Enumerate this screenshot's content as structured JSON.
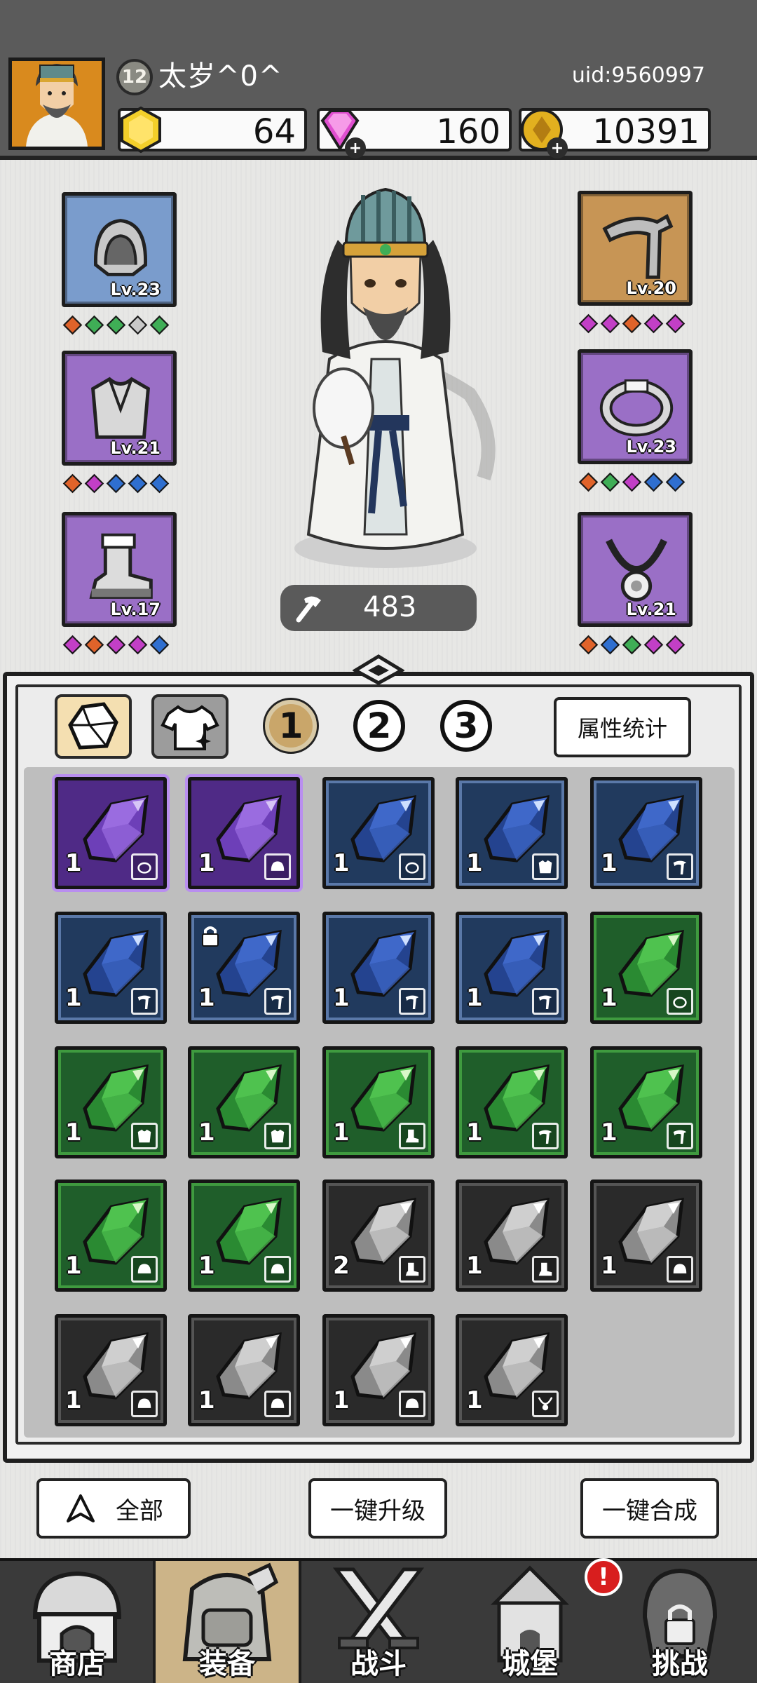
{
  "header": {
    "player_level": "12",
    "player_name": "太岁^0^",
    "uid": "uid:9560997",
    "resources": [
      {
        "icon": "gold-hexagon-icon",
        "value": "64"
      },
      {
        "icon": "pink-diamond-icon",
        "value": "160"
      },
      {
        "icon": "gold-coin-icon",
        "value": "10391"
      }
    ]
  },
  "equipment": {
    "left": [
      {
        "slot": "helmet",
        "level": "Lv.23",
        "rarity_color": "#7a9ccc",
        "gems": [
          "#e0632a",
          "#3fae56",
          "#3fae56",
          "#c8c8c8",
          "#3fae56"
        ]
      },
      {
        "slot": "armor",
        "level": "Lv.21",
        "rarity_color": "#9a6fc6",
        "gems": [
          "#e0632a",
          "#c23fc6",
          "#2f6fd0",
          "#2f6fd0",
          "#2f6fd0"
        ]
      },
      {
        "slot": "boots",
        "level": "Lv.17",
        "rarity_color": "#9a6fc6",
        "gems": [
          "#c23fc6",
          "#e0632a",
          "#c23fc6",
          "#c23fc6",
          "#2f6fd0"
        ]
      }
    ],
    "right": [
      {
        "slot": "weapon",
        "level": "Lv.20",
        "rarity_color": "#c79555",
        "gems": [
          "#c23fc6",
          "#c23fc6",
          "#e0632a",
          "#c23fc6",
          "#c23fc6"
        ]
      },
      {
        "slot": "ring",
        "level": "Lv.23",
        "rarity_color": "#9a6fc6",
        "gems": [
          "#e0632a",
          "#3fae56",
          "#c23fc6",
          "#2f6fd0",
          "#2f6fd0"
        ]
      },
      {
        "slot": "necklace",
        "level": "Lv.21",
        "rarity_color": "#9a6fc6",
        "gems": [
          "#e0632a",
          "#2f6fd0",
          "#3fae56",
          "#c23fc6",
          "#c23fc6"
        ]
      }
    ]
  },
  "combat_power": "483",
  "inventory": {
    "tabs": [
      "gem-tab",
      "equipment-tab"
    ],
    "pages": [
      "1",
      "2",
      "3"
    ],
    "active_page": "1",
    "stats_button": "属性统计",
    "rarity_colors": {
      "purple": "#4f2a86",
      "blue": "#213a5e",
      "green": "#1f5e2a",
      "white": "#2a2a2a"
    },
    "items": [
      {
        "rarity": "purple",
        "count": "1",
        "slot_icon": "ring-icon"
      },
      {
        "rarity": "purple",
        "count": "1",
        "slot_icon": "helmet-icon"
      },
      {
        "rarity": "blue",
        "count": "1",
        "slot_icon": "ring-icon"
      },
      {
        "rarity": "blue",
        "count": "1",
        "slot_icon": "armor-icon"
      },
      {
        "rarity": "blue",
        "count": "1",
        "slot_icon": "weapon-icon"
      },
      {
        "rarity": "blue",
        "count": "1",
        "slot_icon": "weapon-icon"
      },
      {
        "rarity": "blue",
        "count": "1",
        "slot_icon": "weapon-icon",
        "locked": true
      },
      {
        "rarity": "blue",
        "count": "1",
        "slot_icon": "weapon-icon"
      },
      {
        "rarity": "blue",
        "count": "1",
        "slot_icon": "weapon-icon"
      },
      {
        "rarity": "green",
        "count": "1",
        "slot_icon": "ring-icon"
      },
      {
        "rarity": "green",
        "count": "1",
        "slot_icon": "armor-icon"
      },
      {
        "rarity": "green",
        "count": "1",
        "slot_icon": "armor-icon"
      },
      {
        "rarity": "green",
        "count": "1",
        "slot_icon": "boots-icon"
      },
      {
        "rarity": "green",
        "count": "1",
        "slot_icon": "weapon-icon"
      },
      {
        "rarity": "green",
        "count": "1",
        "slot_icon": "weapon-icon"
      },
      {
        "rarity": "green",
        "count": "1",
        "slot_icon": "helmet-icon"
      },
      {
        "rarity": "green",
        "count": "1",
        "slot_icon": "helmet-icon"
      },
      {
        "rarity": "white",
        "count": "2",
        "slot_icon": "boots-icon"
      },
      {
        "rarity": "white",
        "count": "1",
        "slot_icon": "boots-icon"
      },
      {
        "rarity": "white",
        "count": "1",
        "slot_icon": "helmet-icon"
      },
      {
        "rarity": "white",
        "count": "1",
        "slot_icon": "helmet-icon"
      },
      {
        "rarity": "white",
        "count": "1",
        "slot_icon": "helmet-icon"
      },
      {
        "rarity": "white",
        "count": "1",
        "slot_icon": "helmet-icon"
      },
      {
        "rarity": "white",
        "count": "1",
        "slot_icon": "necklace-icon"
      }
    ]
  },
  "actions": {
    "filter_label": "全部",
    "upgrade_all": "一键升级",
    "merge_all": "一键合成"
  },
  "nav": [
    {
      "label": "商店",
      "icon": "shop-icon"
    },
    {
      "label": "装备",
      "icon": "backpack-icon",
      "active": true
    },
    {
      "label": "战斗",
      "icon": "crossed-swords-icon"
    },
    {
      "label": "城堡",
      "icon": "castle-icon",
      "alert": "!"
    },
    {
      "label": "挑战",
      "icon": "locked-helmet-icon"
    }
  ]
}
